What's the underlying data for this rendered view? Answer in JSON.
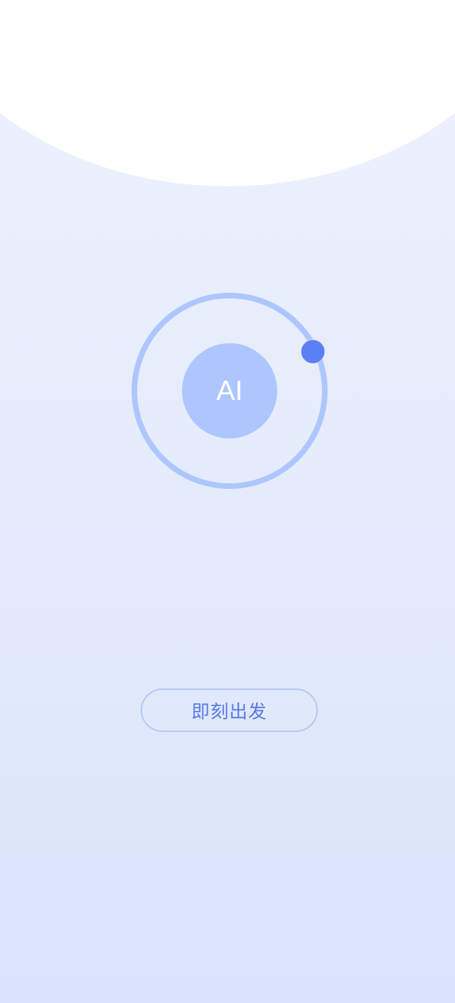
{
  "core": {
    "label": "AI"
  },
  "actions": {
    "start_label": "即刻出发"
  },
  "colors": {
    "background_top": "#eef2fc",
    "background_bottom": "#d9e3fb",
    "orbit_ring": "#adc6fd",
    "core_fill": "#adc6fd",
    "orbit_dot": "#5b7ff5",
    "button_border": "#b3c8f6",
    "button_text": "#5a79e8"
  }
}
